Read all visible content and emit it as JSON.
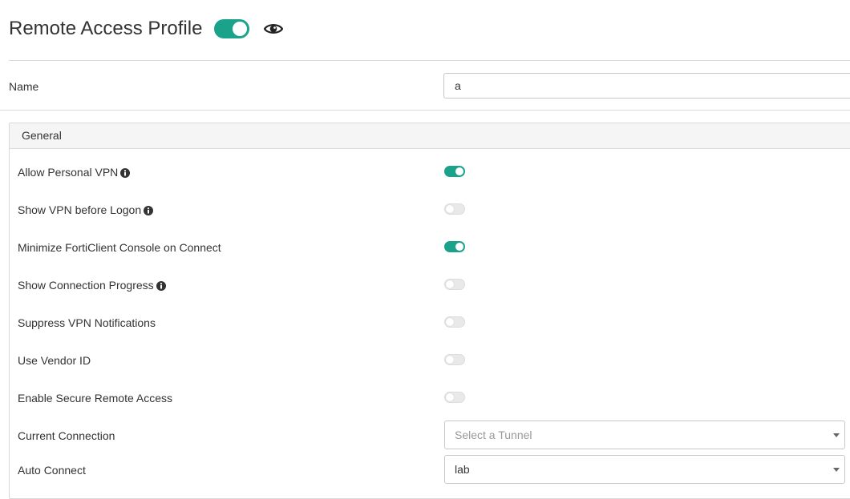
{
  "header": {
    "title": "Remote Access Profile",
    "enabled": true,
    "eye_icon": "eye-icon"
  },
  "name_field": {
    "label": "Name",
    "value": "a"
  },
  "general": {
    "title": "General",
    "toggles": [
      {
        "label": "Allow Personal VPN",
        "info": true,
        "on": true
      },
      {
        "label": "Show VPN before Logon",
        "info": true,
        "on": false
      },
      {
        "label": "Minimize FortiClient Console on Connect",
        "info": false,
        "on": true
      },
      {
        "label": "Show Connection Progress",
        "info": true,
        "on": false
      },
      {
        "label": "Suppress VPN Notifications",
        "info": false,
        "on": false
      },
      {
        "label": "Use Vendor ID",
        "info": false,
        "on": false
      },
      {
        "label": "Enable Secure Remote Access",
        "info": false,
        "on": false
      }
    ],
    "current_connection": {
      "label": "Current Connection",
      "placeholder": "Select a Tunnel"
    },
    "auto_connect": {
      "label": "Auto Connect",
      "value": "lab"
    }
  },
  "colors": {
    "accent": "#1aa38a",
    "border": "#d9d9d9"
  }
}
